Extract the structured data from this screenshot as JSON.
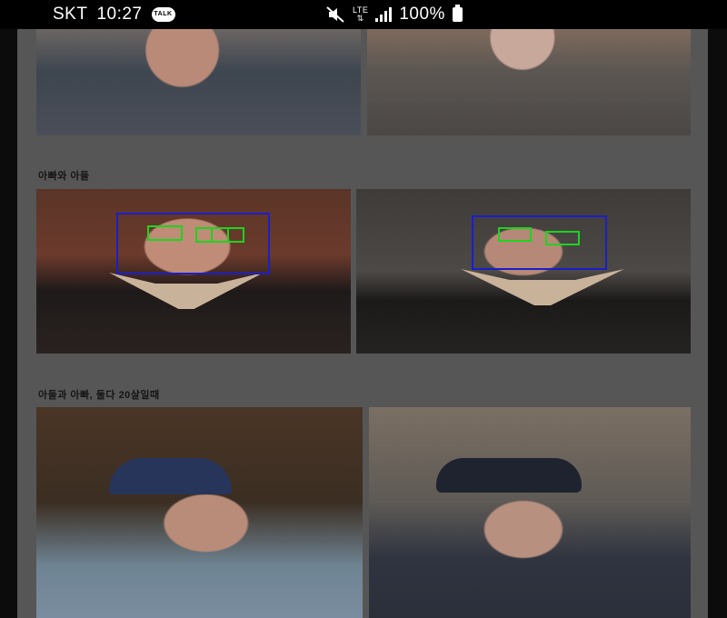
{
  "status_bar": {
    "carrier": "SKT",
    "time": "10:27",
    "talk_badge": "TALK",
    "network": "LTE",
    "battery": "100%"
  },
  "captions": {
    "father_son": "아빠와 아들",
    "son_father_20s": "아들과 아빠, 둘다 20살일때"
  },
  "icons": [
    "talk-icon",
    "mute-icon",
    "lte-icon",
    "signal-icon",
    "battery-icon"
  ],
  "colors": {
    "face_box": "#1b1ec9",
    "eye_box": "#19d61d"
  }
}
